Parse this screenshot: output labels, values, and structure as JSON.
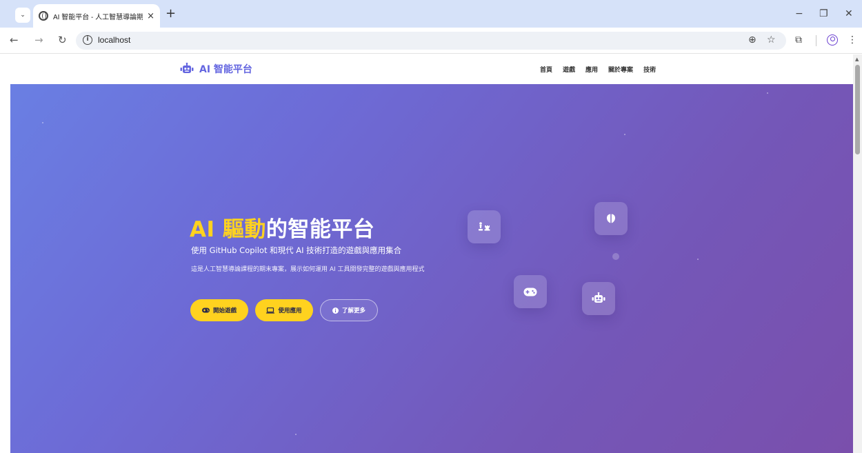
{
  "browser": {
    "tab_title": "AI 智能平台 - 人工智慧導論期末專案",
    "tab_close": "×",
    "new_tab": "+",
    "url": "localhost",
    "info_glyph": "i",
    "icons": {
      "back": "←",
      "forward": "→",
      "reload": "↻",
      "zoom": "⊕",
      "bookmark": "☆",
      "extensions": "⧉",
      "menu": "⋮",
      "minimize": "−",
      "restore": "❐",
      "close": "✕",
      "tab_search": "⌄"
    }
  },
  "site": {
    "brand": "AI 智能平台",
    "nav": [
      "首頁",
      "遊戲",
      "應用",
      "關於專案",
      "技術"
    ]
  },
  "hero": {
    "title_highlight": "AI 驅動",
    "title_rest": "的智能平台",
    "subtitle": "使用 GitHub Copilot 和現代 AI 技術打造的遊戲與應用集合",
    "description": "這是人工智慧導論課程的期末專案，展示如何運用 AI 工具開發完整的遊戲與應用程式",
    "buttons": {
      "play": "開始遊戲",
      "apps": "使用應用",
      "learn": "了解更多"
    },
    "floating_icons": [
      "chess-icon",
      "brain-icon",
      "gamepad-icon",
      "robot-icon"
    ]
  },
  "colors": {
    "accent_yellow": "#ffd21f",
    "brand_purple": "#6466e0",
    "hero_start": "#6a7fe3",
    "hero_end": "#7a4fac"
  }
}
